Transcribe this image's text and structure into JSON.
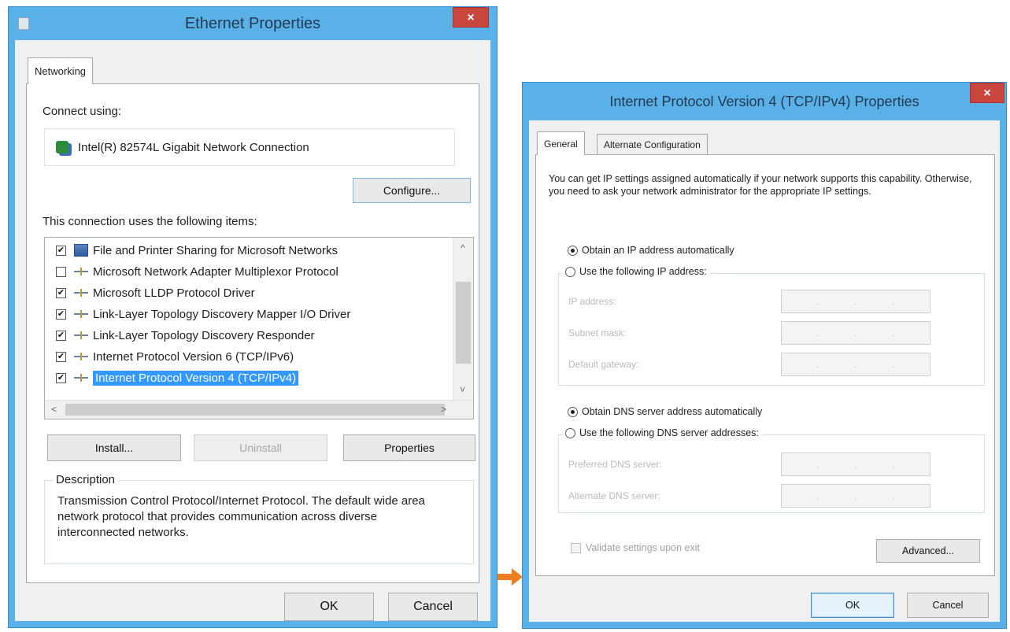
{
  "left_window": {
    "title": "Ethernet Properties",
    "close_glyph": "×",
    "tab_networking": "Networking",
    "connect_using_label": "Connect using:",
    "adapter_name": "Intel(R) 82574L Gigabit Network Connection",
    "configure_label": "Configure...",
    "items_label": "This connection uses the following items:",
    "items": [
      {
        "label": "File and Printer Sharing for Microsoft Networks",
        "checked": "✔",
        "icon": "share-icon"
      },
      {
        "label": "Microsoft Network Adapter Multiplexor Protocol",
        "checked": "",
        "icon": "protocol-icon"
      },
      {
        "label": "Microsoft LLDP Protocol Driver",
        "checked": "✔",
        "icon": "protocol-icon"
      },
      {
        "label": "Link-Layer Topology Discovery Mapper I/O Driver",
        "checked": "✔",
        "icon": "protocol-icon"
      },
      {
        "label": "Link-Layer Topology Discovery Responder",
        "checked": "✔",
        "icon": "protocol-icon"
      },
      {
        "label": "Internet Protocol Version 6 (TCP/IPv6)",
        "checked": "✔",
        "icon": "protocol-icon"
      },
      {
        "label": "Internet Protocol Version 4 (TCP/IPv4)",
        "checked": "✔",
        "icon": "protocol-icon",
        "selected": true
      }
    ],
    "scroll_up": "^",
    "scroll_down": "˅",
    "scroll_left": "<",
    "scroll_right": ">",
    "install_label": "Install...",
    "uninstall_label": "Uninstall",
    "properties_label": "Properties",
    "description_label": "Description",
    "description_text": "Transmission Control Protocol/Internet Protocol. The default wide area network protocol that provides communication across diverse interconnected networks.",
    "ok_label": "OK",
    "cancel_label": "Cancel"
  },
  "right_window": {
    "title": "Internet Protocol Version 4 (TCP/IPv4) Properties",
    "close_glyph": "×",
    "tab_general": "General",
    "tab_alternate": "Alternate Configuration",
    "intro_text": "You can get IP settings assigned automatically if your network supports this capability. Otherwise, you need to ask your network administrator for the appropriate IP settings.",
    "obtain_ip_auto": "Obtain an IP address automatically",
    "use_following_ip": "Use the following IP address:",
    "ip_address_label": "IP address:",
    "subnet_mask_label": "Subnet mask:",
    "default_gateway_label": "Default gateway:",
    "obtain_dns_auto": "Obtain DNS server address automatically",
    "use_following_dns": "Use the following DNS server addresses:",
    "preferred_dns_label": "Preferred DNS server:",
    "alternate_dns_label": "Alternate DNS server:",
    "ip_dots": ".",
    "validate_label": "Validate settings upon exit",
    "advanced_label": "Advanced...",
    "ok_label": "OK",
    "cancel_label": "Cancel"
  },
  "colors": {
    "title_bar": "#5ab1e8",
    "close_button": "#c9463f",
    "selection": "#3399ff",
    "arrow": "#f07d1e"
  }
}
